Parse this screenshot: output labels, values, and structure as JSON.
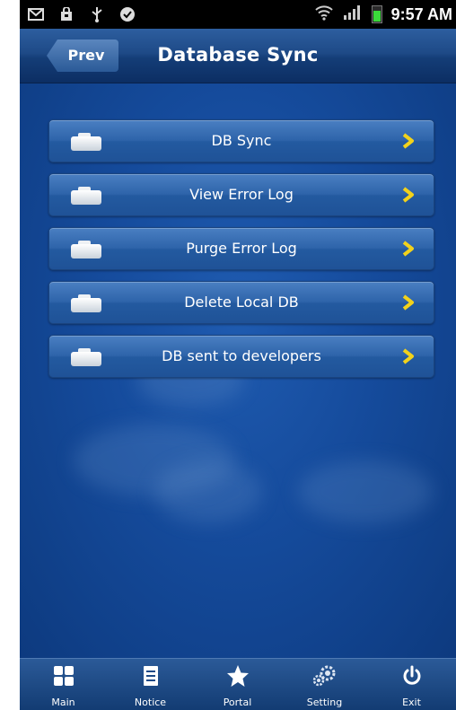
{
  "status_bar": {
    "time": "9:57 AM"
  },
  "header": {
    "back_label": "Prev",
    "title": "Database Sync"
  },
  "menu": {
    "items": [
      {
        "label": "DB Sync"
      },
      {
        "label": "View Error Log"
      },
      {
        "label": "Purge Error Log"
      },
      {
        "label": "Delete Local DB"
      },
      {
        "label": "DB sent to developers"
      }
    ]
  },
  "bottom_nav": {
    "items": [
      {
        "label": "Main",
        "icon": "grid-icon"
      },
      {
        "label": "Notice",
        "icon": "document-icon"
      },
      {
        "label": "Portal",
        "icon": "star-icon"
      },
      {
        "label": "Setting",
        "icon": "gear-icon"
      },
      {
        "label": "Exit",
        "icon": "power-icon"
      }
    ]
  },
  "colors": {
    "accent_chevron": "#f2d21b",
    "header": "#1e4a87",
    "background": "#154b9c"
  }
}
